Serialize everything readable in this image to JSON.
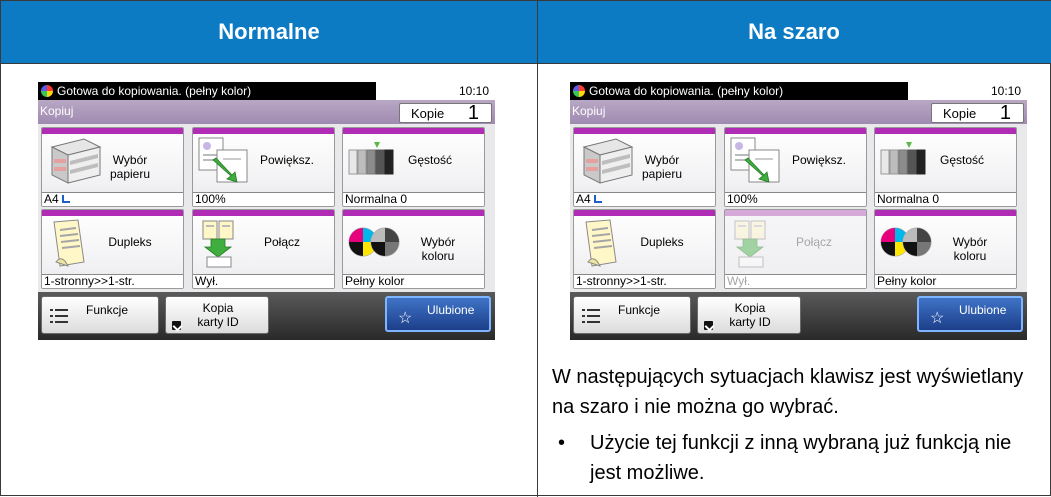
{
  "table": {
    "headers": [
      "Normalne",
      "Na szaro"
    ]
  },
  "panels": [
    {
      "status": "Gotowa do kopiowania. (pełny kolor)",
      "time": "10:10",
      "title": "Kopiuj",
      "copies_label": "Kopie",
      "copies_value": "1",
      "tiles": [
        {
          "label": "Wybór papieru",
          "value": "A4",
          "icon": "paper-tray-icon",
          "disabled": false
        },
        {
          "label": "Powiększ.",
          "value": "100%",
          "icon": "zoom-icon",
          "disabled": false
        },
        {
          "label": "Gęstość",
          "value": "Normalna 0",
          "icon": "density-icon",
          "disabled": false
        },
        {
          "label": "Dupleks",
          "value": "1-stronny>>1-str.",
          "icon": "duplex-icon",
          "disabled": false
        },
        {
          "label": "Połącz",
          "value": "Wył.",
          "icon": "combine-icon",
          "disabled": false
        },
        {
          "label": "Wybór koloru",
          "value": "Pełny kolor",
          "icon": "color-select-icon",
          "disabled": false
        }
      ],
      "buttons": {
        "functions": "Funkcje",
        "id_copy": "Kopia karty ID",
        "favorites": "Ulubione"
      }
    },
    {
      "status": "Gotowa do kopiowania. (pełny kolor)",
      "time": "10:10",
      "title": "Kopiuj",
      "copies_label": "Kopie",
      "copies_value": "1",
      "tiles": [
        {
          "label": "Wybór papieru",
          "value": "A4",
          "icon": "paper-tray-icon",
          "disabled": false
        },
        {
          "label": "Powiększ.",
          "value": "100%",
          "icon": "zoom-icon",
          "disabled": false
        },
        {
          "label": "Gęstość",
          "value": "Normalna 0",
          "icon": "density-icon",
          "disabled": false
        },
        {
          "label": "Dupleks",
          "value": "1-stronny>>1-str.",
          "icon": "duplex-icon",
          "disabled": false
        },
        {
          "label": "Połącz",
          "value": "Wył.",
          "icon": "combine-icon",
          "disabled": true
        },
        {
          "label": "Wybór koloru",
          "value": "Pełny kolor",
          "icon": "color-select-icon",
          "disabled": false
        }
      ],
      "buttons": {
        "functions": "Funkcje",
        "id_copy": "Kopia karty ID",
        "favorites": "Ulubione"
      }
    }
  ],
  "note": {
    "text": "W następujących sytuacjach klawisz jest wyświetlany na szaro i nie można go wybrać.",
    "bullet": "Użycie tej funkcji z inną wybraną już funkcją nie jest możliwe."
  },
  "colors": {
    "header_bg": "#0c7bc4",
    "tile_accent": "#b02cb5",
    "title_bar": "#9f8bb0",
    "favorites_bg": "#1c3f8a"
  }
}
